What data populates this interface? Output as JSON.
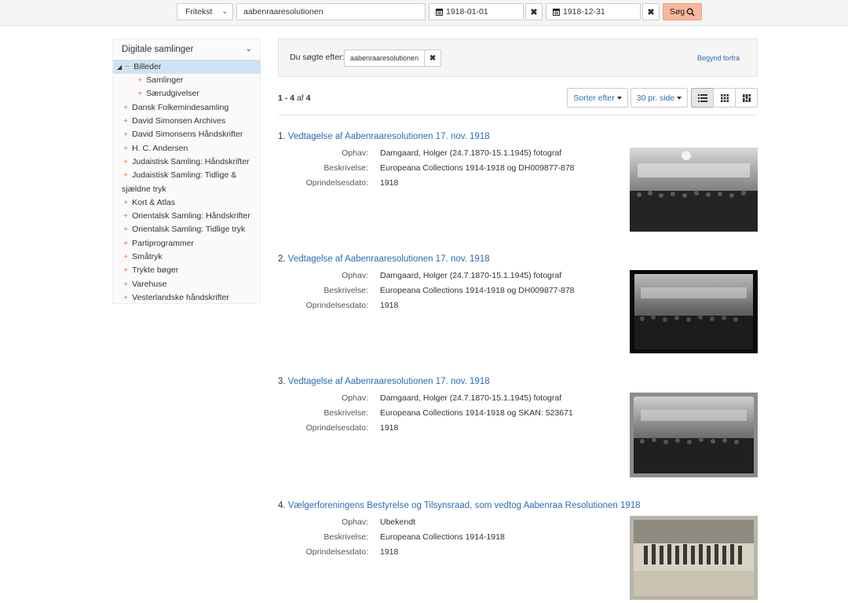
{
  "search": {
    "type_label": "Fritekst",
    "query": "aabenraaresolutionen",
    "date_from": "1918-01-01",
    "date_to": "1918-12-31",
    "button_label": "Søg"
  },
  "sidebar": {
    "header": "Digitale samlinger",
    "selected": "Billeder",
    "sub_items": [
      "Samlinger",
      "Særudgivelser"
    ],
    "items": [
      "Dansk Folkemindesamling",
      "David Simonsen Archives",
      "David Simonsens Håndskrifter",
      "H. C. Andersen",
      "Judaistisk Samling: Håndskrifter",
      "Judaistisk Samling: Tidlige &",
      "sjældne tryk",
      "Kort & Atlas",
      "Orientalsk Samling: Håndskrifter",
      "Orientalsk Samling: Tidlige tryk",
      "Partiprogrammer",
      "Småtryk",
      "Trykte bøger",
      "Varehuse",
      "Vesterlandske håndskrifter"
    ]
  },
  "constraints": {
    "label": "Du søgte efter:",
    "value": "aabenraaresolutionen",
    "reset": "Begynd forfra"
  },
  "results_info": {
    "range": "1 - 4",
    "of": "af",
    "total": "4",
    "sort_label": "Sorter efter",
    "per_page_label": "30 pr. side"
  },
  "field_labels": {
    "origin": "Ophav:",
    "description": "Beskrivelse:",
    "date": "Oprindelsesdato:"
  },
  "results": [
    {
      "num": "1.",
      "title": "Vedtagelse af Aabenraaresolutionen 17. nov. 1918",
      "origin": "Damgaard, Holger (24.7.1870-15.1.1945) fotograf",
      "description": "Europeana Collections 1914-1918 og DH009877-878",
      "date": "1918"
    },
    {
      "num": "2.",
      "title": "Vedtagelse af Aabenraaresolutionen 17. nov. 1918",
      "origin": "Damgaard, Holger (24.7.1870-15.1.1945) fotograf",
      "description": "Europeana Collections 1914-1918 og DH009877-878",
      "date": "1918"
    },
    {
      "num": "3.",
      "title": "Vedtagelse af Aabenraaresolutionen 17. nov. 1918",
      "origin": "Damgaard, Holger (24.7.1870-15.1.1945) fotograf",
      "description": "Europeana Collections 1914-1918 og SKAN: 523671",
      "date": "1918"
    },
    {
      "num": "4.",
      "title": "Vælgerforeningens Bestyrelse og Tilsynsraad, som vedtog Aabenraa Resolutionen 1918",
      "origin": "Ubekendt",
      "description": "Europeana Collections 1914-1918",
      "date": "1918"
    }
  ],
  "colors": {
    "link": "#2a6fb5",
    "accent": "#e8743f",
    "search_button": "#f7b89c",
    "selected_row": "#cfe3f2"
  }
}
